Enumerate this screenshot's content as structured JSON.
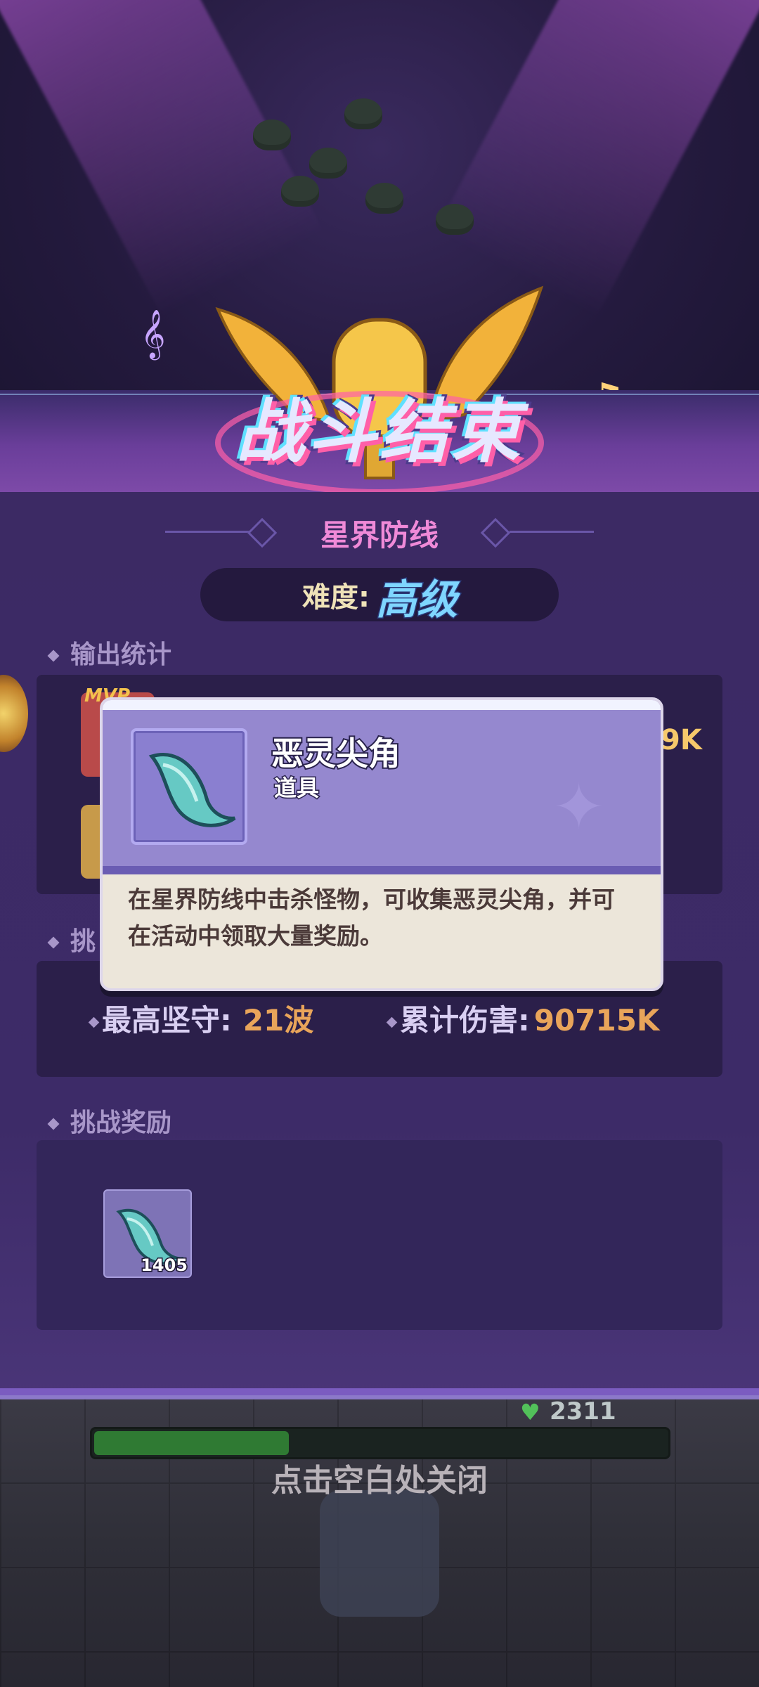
{
  "header": {
    "title": "战斗结束",
    "stage_name": "星界防线",
    "difficulty_label": "难度:",
    "difficulty_value": "高级"
  },
  "output_stats": {
    "section_title": "输出统计",
    "badge": "MVP",
    "partial_value": "9K"
  },
  "challenge_stats": {
    "section_title": "挑",
    "max_hold_label": "最高坚守:",
    "max_hold_value": "21波",
    "total_damage_label": "累计伤害:",
    "total_damage_value": "90715K"
  },
  "rewards": {
    "section_title": "挑战奖励",
    "items": [
      {
        "icon": "spirit-horn-icon",
        "count": "1405"
      }
    ]
  },
  "tooltip": {
    "item_name": "恶灵尖角",
    "item_type": "道具",
    "description": "在星界防线中击杀怪物，可收集恶灵尖角，并可在活动中领取大量奖励。",
    "icon": "spirit-horn-icon"
  },
  "game_hud": {
    "hp_value": "2311",
    "hp_fraction": 0.34
  },
  "close_hint": "点击空白处关闭",
  "colors": {
    "accent_pink": "#f08ad8",
    "value_orange": "#e9a55a",
    "panel_purple": "#3c2a64",
    "tooltip_header": "#9588cf"
  }
}
